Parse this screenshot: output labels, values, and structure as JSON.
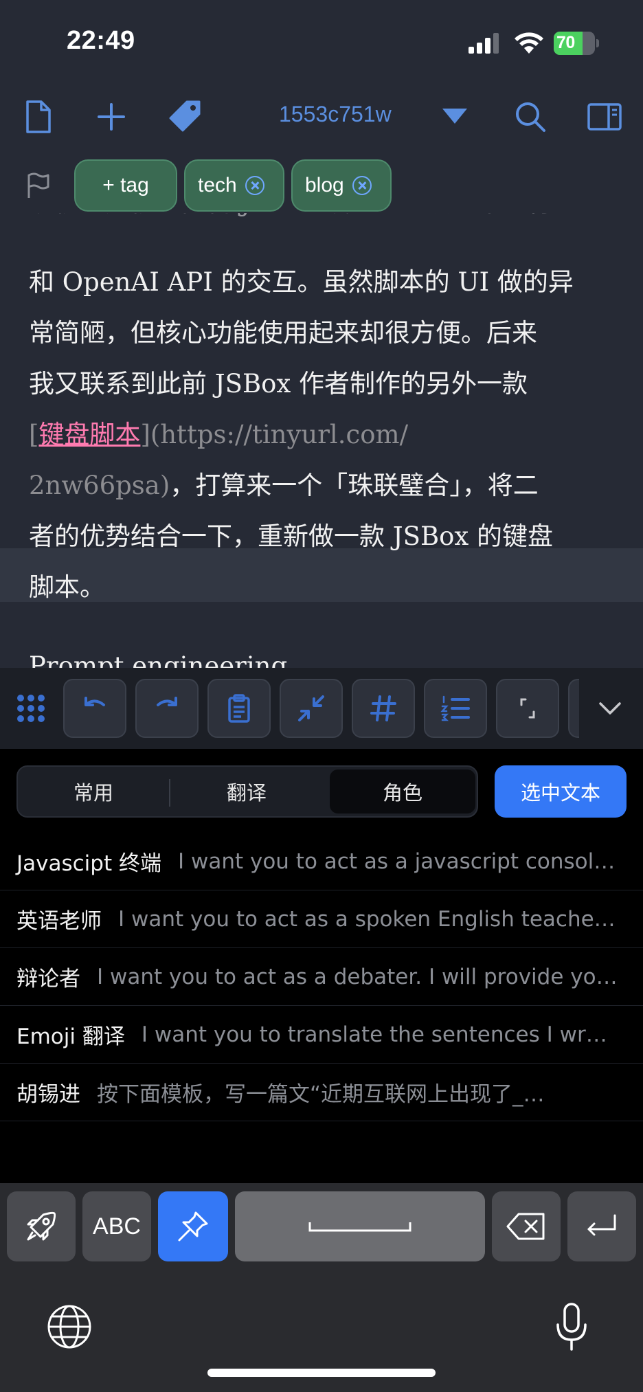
{
  "status_bar": {
    "time": "22:49",
    "battery": "70"
  },
  "toolbar": {
    "doc_id": "1553c751w"
  },
  "tags": [
    {
      "label": "+ tag"
    },
    {
      "label": "tech"
    },
    {
      "label": "blog"
    }
  ],
  "content": {
    "lines": [
      "该核为如依的能台 JSBox 硬盘上的按钮来进行",
      "和 OpenAI API 的交互。虽然脚本的 UI 做的异",
      "常简陋，但核心功能使用起来却很方便。后来",
      "我又联系到此前 JSBox 作者制作的另外一款"
    ],
    "link_open": "[",
    "link_text": "键盘脚本",
    "link_url_a": "](https://tinyurl.com/",
    "link_url_b": "2nw66psa)",
    "after_link": "，打算来一个「珠联璧合」，将二",
    "line7": "者的优势结合一下，重新做一款 JSBox 的键盘",
    "line8": "脚本。",
    "heading_partial": "Prompt engineering"
  },
  "segments": {
    "items": [
      "常用",
      "翻译",
      "角色"
    ],
    "active": "角色"
  },
  "select_button": "选中文本",
  "prompts": [
    {
      "name": "Javascipt 终端",
      "text": "I want you to act as a javascript consol…"
    },
    {
      "name": "英语老师",
      "text": "I want you to act as a spoken English teache…"
    },
    {
      "name": "辩论者",
      "text": "I want you to act as a debater. I will provide yo…"
    },
    {
      "name": "Emoji 翻译",
      "text": "I want you to translate the sentences I wr…"
    },
    {
      "name": "胡锡进",
      "text": "按下面模板，写一篇文“近期互联网上出现了_…"
    }
  ],
  "keys": {
    "abc": "ABC"
  },
  "colors": {
    "accent": "#3478f6",
    "editor_bg": "#262a35",
    "tag_bg": "#3a6a52",
    "link": "#ff7bb0"
  },
  "icons": [
    "document-icon",
    "plus-icon",
    "tag-icon",
    "chevron-down-icon",
    "search-icon",
    "sidebar-icon",
    "flag-icon",
    "grid-icon",
    "undo-icon",
    "redo-icon",
    "clipboard-icon",
    "collapse-icon",
    "hashtag-icon",
    "list-icon",
    "bracket-icon",
    "rocket-icon",
    "pin-icon",
    "backspace-icon",
    "return-icon",
    "globe-icon",
    "microphone-icon"
  ]
}
